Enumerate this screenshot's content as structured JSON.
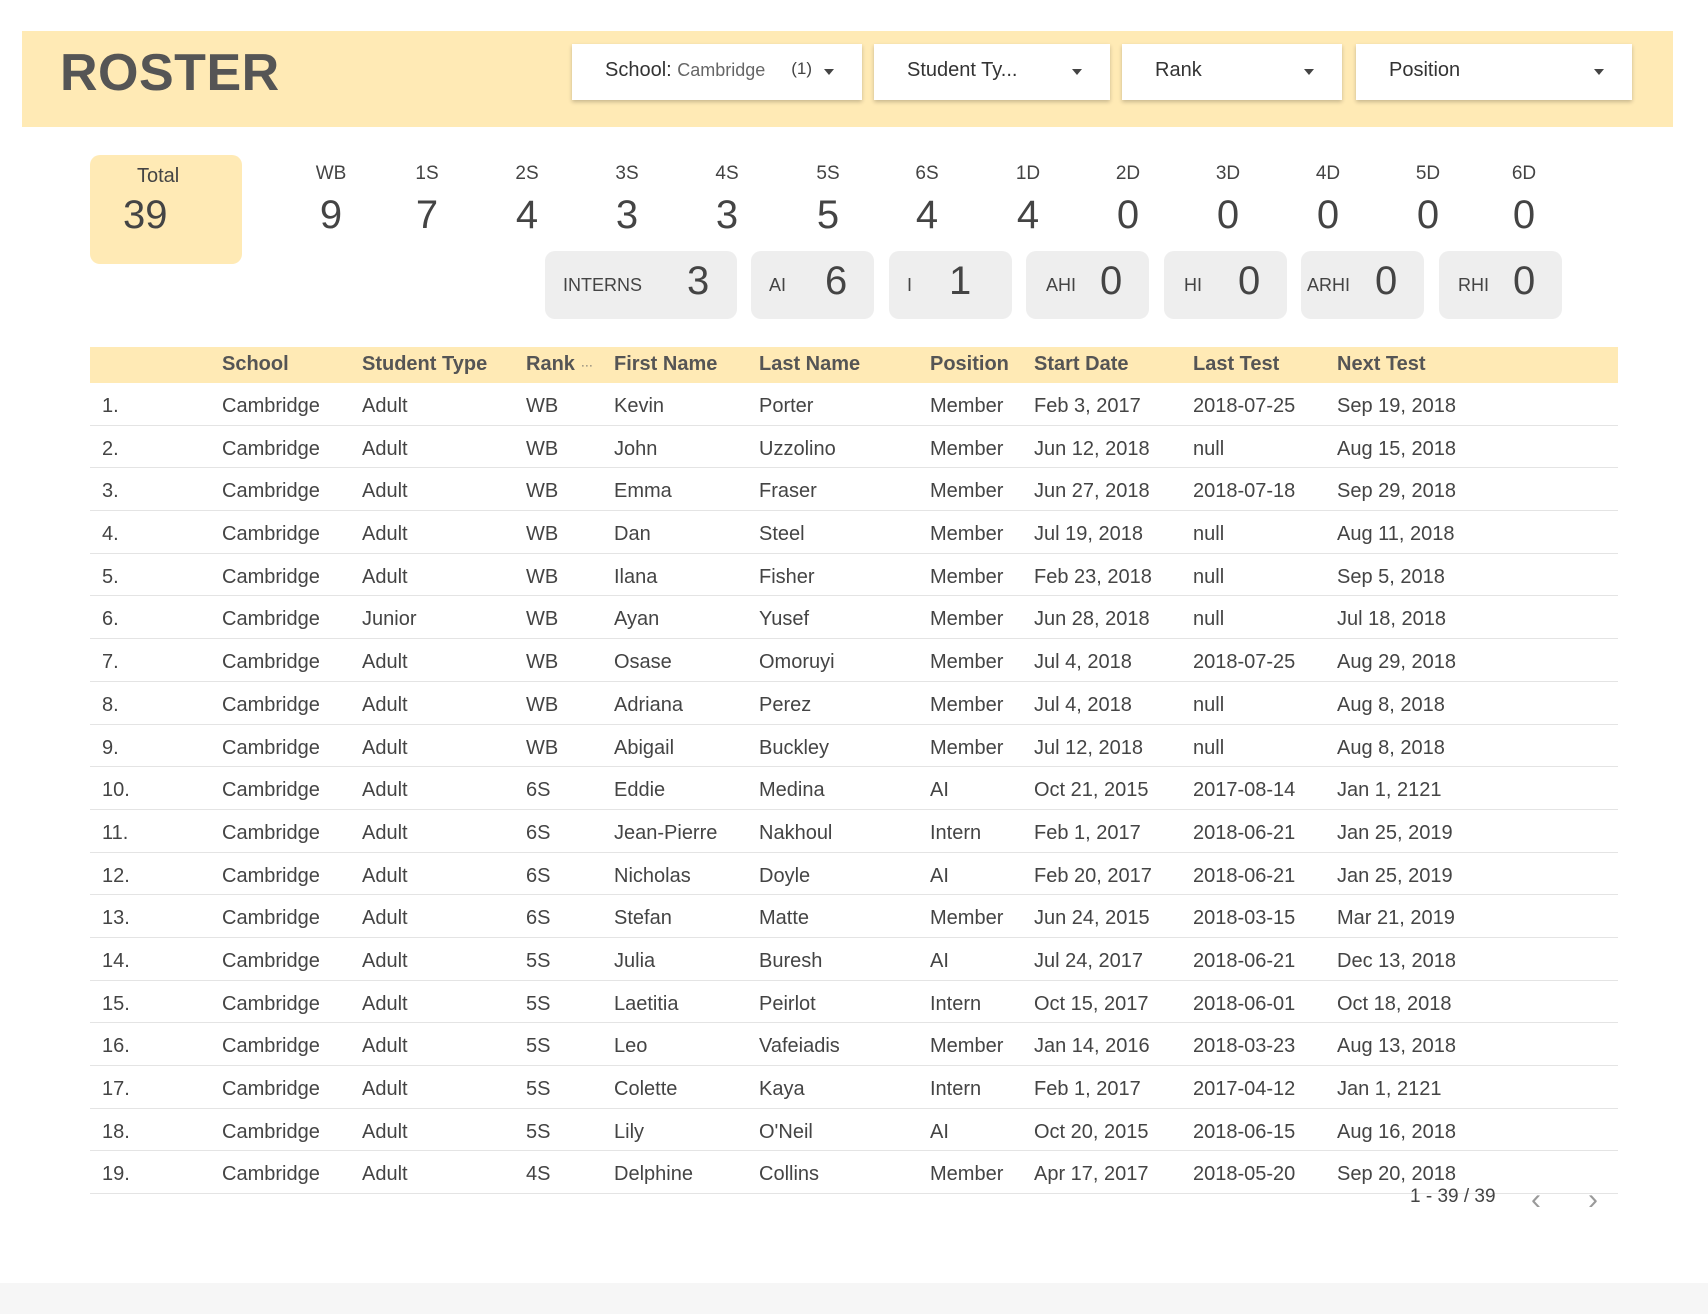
{
  "header": {
    "title": "ROSTER",
    "filters": [
      {
        "label": "School:",
        "value": "Cambridge",
        "count": "(1)"
      },
      {
        "label": "Student Ty...",
        "value": "",
        "count": ""
      },
      {
        "label": "Rank",
        "value": "",
        "count": ""
      },
      {
        "label": "Position",
        "value": "",
        "count": ""
      }
    ]
  },
  "stats": {
    "total": {
      "label": "Total",
      "value": "39"
    },
    "ranks": [
      {
        "label": "WB",
        "value": "9"
      },
      {
        "label": "1S",
        "value": "7"
      },
      {
        "label": "2S",
        "value": "4"
      },
      {
        "label": "3S",
        "value": "3"
      },
      {
        "label": "4S",
        "value": "3"
      },
      {
        "label": "5S",
        "value": "5"
      },
      {
        "label": "6S",
        "value": "4"
      },
      {
        "label": "1D",
        "value": "4"
      },
      {
        "label": "2D",
        "value": "0"
      },
      {
        "label": "3D",
        "value": "0"
      },
      {
        "label": "4D",
        "value": "0"
      },
      {
        "label": "5D",
        "value": "0"
      },
      {
        "label": "6D",
        "value": "0"
      }
    ],
    "positions": [
      {
        "label": "INTERNS",
        "value": "3"
      },
      {
        "label": "AI",
        "value": "6"
      },
      {
        "label": "I",
        "value": "1"
      },
      {
        "label": "AHI",
        "value": "0"
      },
      {
        "label": "HI",
        "value": "0"
      },
      {
        "label": "ARHI",
        "value": "0"
      },
      {
        "label": "RHI",
        "value": "0"
      }
    ]
  },
  "table": {
    "columns": [
      "",
      "School",
      "Student Type",
      "Rank",
      "First Name",
      "Last Name",
      "Position",
      "Start Date",
      "Last Test",
      "Next Test"
    ],
    "rows": [
      [
        "1.",
        "Cambridge",
        "Adult",
        "WB",
        "Kevin",
        "Porter",
        "Member",
        "Feb 3, 2017",
        "2018-07-25",
        "Sep 19, 2018"
      ],
      [
        "2.",
        "Cambridge",
        "Adult",
        "WB",
        "John",
        "Uzzolino",
        "Member",
        "Jun 12, 2018",
        "null",
        "Aug 15, 2018"
      ],
      [
        "3.",
        "Cambridge",
        "Adult",
        "WB",
        "Emma",
        "Fraser",
        "Member",
        "Jun 27, 2018",
        "2018-07-18",
        "Sep 29, 2018"
      ],
      [
        "4.",
        "Cambridge",
        "Adult",
        "WB",
        "Dan",
        "Steel",
        "Member",
        "Jul 19, 2018",
        "null",
        "Aug 11, 2018"
      ],
      [
        "5.",
        "Cambridge",
        "Adult",
        "WB",
        "Ilana",
        "Fisher",
        "Member",
        "Feb 23, 2018",
        "null",
        "Sep 5, 2018"
      ],
      [
        "6.",
        "Cambridge",
        "Junior",
        "WB",
        "Ayan",
        "Yusef",
        "Member",
        "Jun 28, 2018",
        "null",
        "Jul 18, 2018"
      ],
      [
        "7.",
        "Cambridge",
        "Adult",
        "WB",
        "Osase",
        "Omoruyi",
        "Member",
        "Jul 4, 2018",
        "2018-07-25",
        "Aug 29, 2018"
      ],
      [
        "8.",
        "Cambridge",
        "Adult",
        "WB",
        "Adriana",
        "Perez",
        "Member",
        "Jul 4, 2018",
        "null",
        "Aug 8, 2018"
      ],
      [
        "9.",
        "Cambridge",
        "Adult",
        "WB",
        "Abigail",
        "Buckley",
        "Member",
        "Jul 12, 2018",
        "null",
        "Aug 8, 2018"
      ],
      [
        "10.",
        "Cambridge",
        "Adult",
        "6S",
        "Eddie",
        "Medina",
        "AI",
        "Oct 21, 2015",
        "2017-08-14",
        "Jan 1, 2121"
      ],
      [
        "11.",
        "Cambridge",
        "Adult",
        "6S",
        "Jean-Pierre",
        "Nakhoul",
        "Intern",
        "Feb 1, 2017",
        "2018-06-21",
        "Jan 25, 2019"
      ],
      [
        "12.",
        "Cambridge",
        "Adult",
        "6S",
        "Nicholas",
        "Doyle",
        "AI",
        "Feb 20, 2017",
        "2018-06-21",
        "Jan 25, 2019"
      ],
      [
        "13.",
        "Cambridge",
        "Adult",
        "6S",
        "Stefan",
        "Matte",
        "Member",
        "Jun 24, 2015",
        "2018-03-15",
        "Mar 21, 2019"
      ],
      [
        "14.",
        "Cambridge",
        "Adult",
        "5S",
        "Julia",
        "Buresh",
        "AI",
        "Jul 24, 2017",
        "2018-06-21",
        "Dec 13, 2018"
      ],
      [
        "15.",
        "Cambridge",
        "Adult",
        "5S",
        "Laetitia",
        "Peirlot",
        "Intern",
        "Oct 15, 2017",
        "2018-06-01",
        "Oct 18, 2018"
      ],
      [
        "16.",
        "Cambridge",
        "Adult",
        "5S",
        "Leo",
        "Vafeiadis",
        "Member",
        "Jan 14, 2016",
        "2018-03-23",
        "Aug 13, 2018"
      ],
      [
        "17.",
        "Cambridge",
        "Adult",
        "5S",
        "Colette",
        "Kaya",
        "Intern",
        "Feb 1, 2017",
        "2017-04-12",
        "Jan 1, 2121"
      ],
      [
        "18.",
        "Cambridge",
        "Adult",
        "5S",
        "Lily",
        "O'Neil",
        "AI",
        "Oct 20, 2015",
        "2018-06-15",
        "Aug 16, 2018"
      ],
      [
        "19.",
        "Cambridge",
        "Adult",
        "4S",
        "Delphine",
        "Collins",
        "Member",
        "Apr 17, 2017",
        "2018-05-20",
        "Sep 20, 2018"
      ]
    ]
  },
  "pagination": {
    "range": "1 - 39 / 39",
    "prev_icon": "chevron-left-icon",
    "next_icon": "chevron-right-icon"
  },
  "colors": {
    "accent": "#ffeab5",
    "chip": "#eeeeee",
    "text": "#444444"
  }
}
